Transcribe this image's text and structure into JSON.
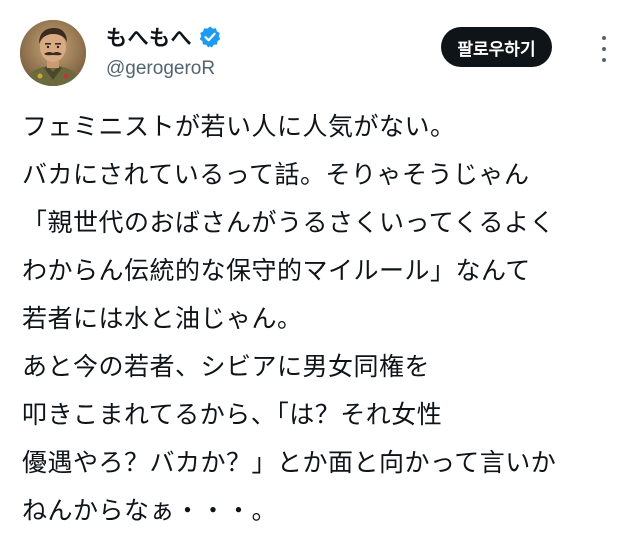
{
  "author": {
    "display_name": "もへもへ",
    "handle": "@gerogeroR",
    "verified": true,
    "verified_color": "#1d9bf0",
    "avatar": "avatar-portrait"
  },
  "actions": {
    "follow_label": "팔로우하기",
    "more_icon": "more-vertical-icon"
  },
  "tweet": {
    "lines": [
      "フェミニストが若い人に人気がない。",
      "バカにされているって話。そりゃそうじゃん",
      "「親世代のおばさんがうるさくいってくるよく",
      "わからん伝統的な保守的マイルール」なんて",
      "若者には水と油じゃん。",
      "あと今の若者、シビアに男女同権を",
      "叩きこまれてるから、「は？それ女性",
      "優遇やろ？バカか？」とか面と向かって言いか",
      "ねんからなぁ・・・。"
    ]
  },
  "colors": {
    "text": "#0f1419",
    "secondary": "#536471",
    "button_bg": "#0f1419",
    "button_text": "#ffffff"
  }
}
